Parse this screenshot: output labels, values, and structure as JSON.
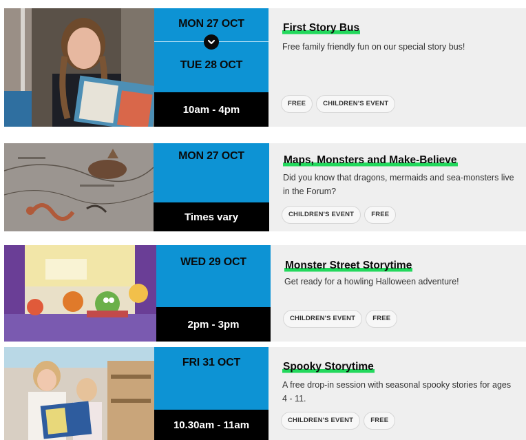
{
  "colors": {
    "date_bg": "#0d93d4",
    "time_bg": "#000000",
    "info_bg": "#efefef",
    "title_highlight": "#22d85c"
  },
  "events": [
    {
      "image_icon": "storyteller-photo",
      "date_start": "MON 27 OCT",
      "date_end": "TUE 28 OCT",
      "time": "10am - 4pm",
      "title": "First Story Bus",
      "description": "Free family friendly fun on our special story bus!",
      "tags": [
        "FREE",
        "CHILDREN'S EVENT"
      ]
    },
    {
      "image_icon": "old-map-sea-monster",
      "date_start": "MON 27 OCT",
      "time": "Times vary",
      "title": "Maps, Monsters and Make-Believe",
      "description": "Did you know that dragons, mermaids and sea-monsters live in the Forum?",
      "tags": [
        "CHILDREN'S EVENT",
        "FREE"
      ]
    },
    {
      "image_icon": "monster-street-illustration",
      "date_start": "WED 29 OCT",
      "time": "2pm - 3pm",
      "title": "Monster Street Storytime",
      "description": "Get ready for a howling Halloween adventure!",
      "tags": [
        "CHILDREN'S EVENT",
        "FREE"
      ]
    },
    {
      "image_icon": "children-reading-photo",
      "date_start": "FRI 31 OCT",
      "time": "10.30am - 11am",
      "title": "Spooky Storytime",
      "description": "A free drop-in session with seasonal spooky stories for ages 4 - 11.",
      "tags": [
        "CHILDREN'S EVENT",
        "FREE"
      ]
    }
  ]
}
